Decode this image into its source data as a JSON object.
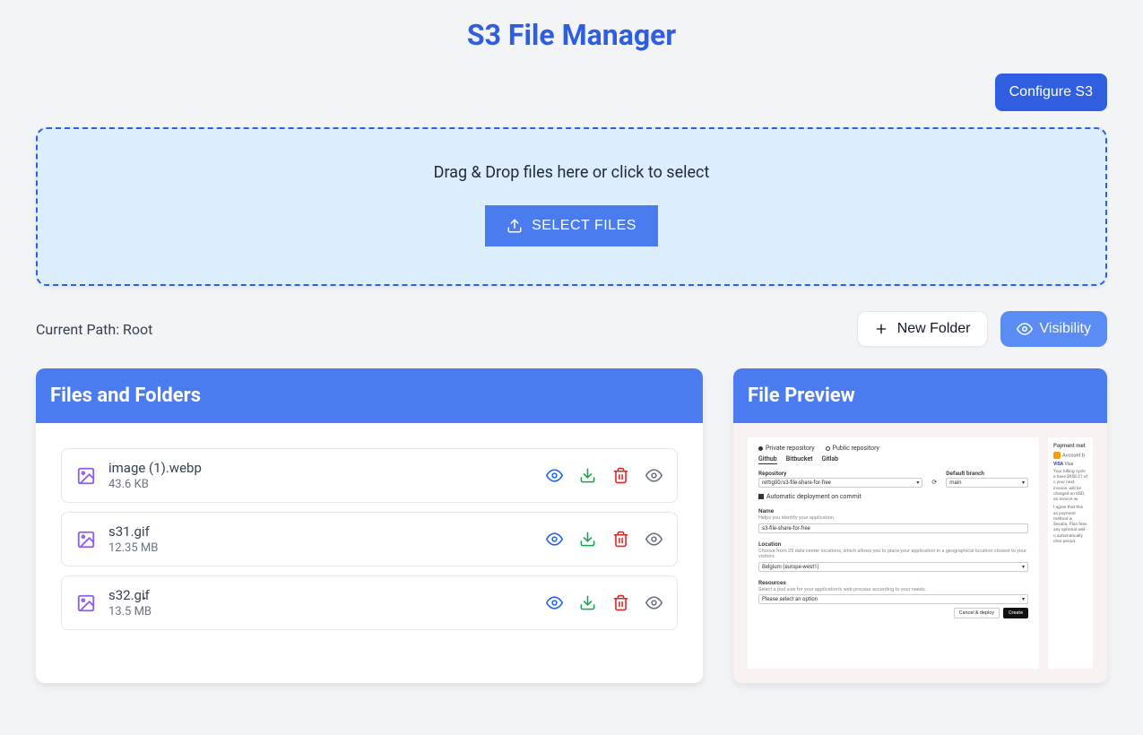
{
  "header": {
    "title": "S3 File Manager",
    "configure_button": "Configure S3"
  },
  "dropzone": {
    "text": "Drag & Drop files here or click to select",
    "select_button": "SELECT FILES"
  },
  "path": {
    "label": "Current Path: Root",
    "new_folder_button": "New Folder",
    "visibility_button": "Visibility"
  },
  "panels": {
    "files_title": "Files and Folders",
    "preview_title": "File Preview"
  },
  "files": [
    {
      "name": "image (1).webp",
      "size": "43.6 KB"
    },
    {
      "name": "s31.gif",
      "size": "12.35 MB"
    },
    {
      "name": "s32.gif",
      "size": "13.5 MB"
    }
  ],
  "preview": {
    "repo_type_private": "Private repository",
    "repo_type_public": "Public repository",
    "tabs": [
      "Github",
      "Bitbucket",
      "Gitlab"
    ],
    "repository_label": "Repository",
    "repository_value": "rettig00/s3-file-share-for-free",
    "default_branch_label": "Default branch",
    "default_branch_value": "main",
    "auto_deploy": "Automatic deployment on commit",
    "name_label": "Name",
    "name_hint": "Helps you identify your application.",
    "name_value": "s3-file-share-for-free",
    "location_label": "Location",
    "location_hint": "Choose from 25 data center locations, which allows you to place your application in a geographical location closest to your visitors.",
    "location_value": "Belgium (europe-west1)",
    "resources_label": "Resources",
    "resources_hint": "Select a pod size for your application's web process according to your needs.",
    "resources_value": "Please select an option",
    "cancel_button": "Cancel & deploy",
    "create_button": "Create",
    "side_payment": "Payment met",
    "side_account": "Account b",
    "side_visa": "VISA Visa",
    "side_billing": "Your billing cycle e have $958.31 of c your next invoice. will be charged on USD, an invoice wi",
    "side_agree": "I agree that this ac payment method w Sevalla. Plan fees any optional add-o automatically char period."
  }
}
